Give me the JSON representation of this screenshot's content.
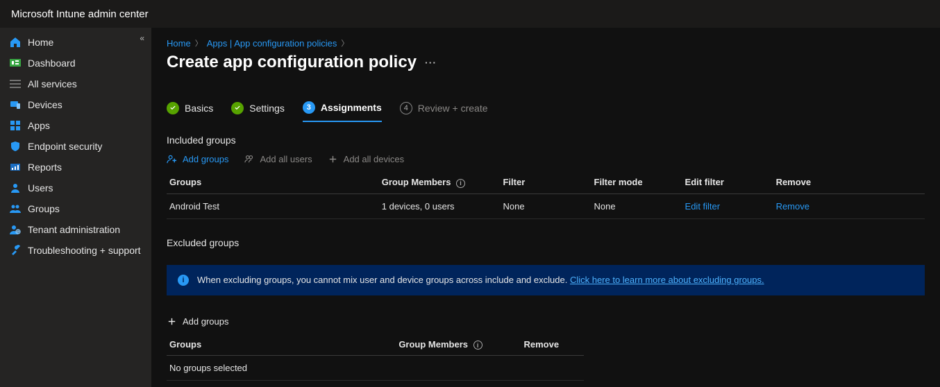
{
  "header": {
    "product": "Microsoft Intune admin center"
  },
  "sidebar": {
    "items": [
      {
        "label": "Home"
      },
      {
        "label": "Dashboard"
      },
      {
        "label": "All services"
      },
      {
        "label": "Devices"
      },
      {
        "label": "Apps"
      },
      {
        "label": "Endpoint security"
      },
      {
        "label": "Reports"
      },
      {
        "label": "Users"
      },
      {
        "label": "Groups"
      },
      {
        "label": "Tenant administration"
      },
      {
        "label": "Troubleshooting + support"
      }
    ]
  },
  "breadcrumb": {
    "home": "Home",
    "apps": "Apps | App configuration policies"
  },
  "page": {
    "title": "Create app configuration policy"
  },
  "steps": {
    "s1": "Basics",
    "s2": "Settings",
    "s3": "Assignments",
    "s3_num": "3",
    "s4": "Review + create",
    "s4_num": "4"
  },
  "included": {
    "heading": "Included groups",
    "add_groups": "Add groups",
    "add_all_users": "Add all users",
    "add_all_devices": "Add all devices",
    "cols": {
      "groups": "Groups",
      "members": "Group Members",
      "filter": "Filter",
      "filter_mode": "Filter mode",
      "edit_filter": "Edit filter",
      "remove": "Remove"
    },
    "rows": [
      {
        "group": "Android Test",
        "members": "1 devices, 0 users",
        "filter": "None",
        "filter_mode": "None",
        "edit_filter": "Edit filter",
        "remove": "Remove"
      }
    ]
  },
  "excluded": {
    "heading": "Excluded groups",
    "banner_text": "When excluding groups, you cannot mix user and device groups across include and exclude.",
    "banner_link": "Click here to learn more about excluding groups.",
    "add_groups": "Add groups",
    "cols": {
      "groups": "Groups",
      "members": "Group Members",
      "remove": "Remove"
    },
    "empty": "No groups selected"
  }
}
